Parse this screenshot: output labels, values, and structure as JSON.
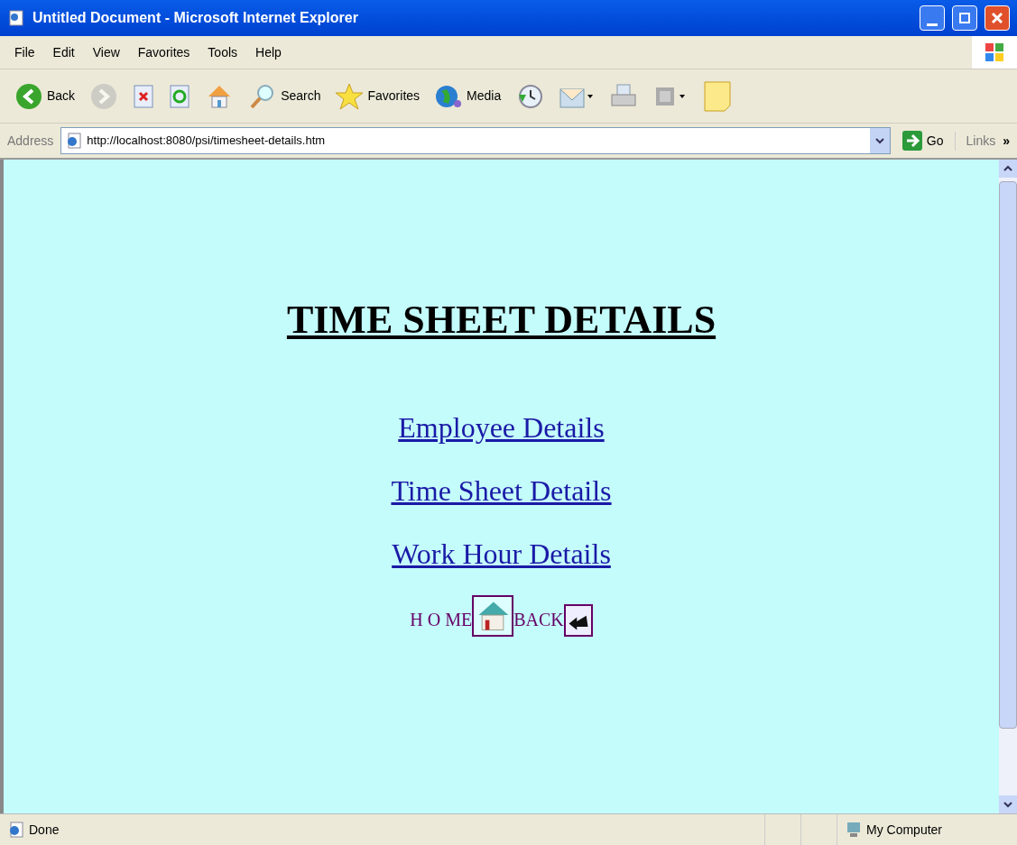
{
  "window": {
    "title": "Untitled Document - Microsoft Internet Explorer"
  },
  "menu": [
    "File",
    "Edit",
    "View",
    "Favorites",
    "Tools",
    "Help"
  ],
  "toolbar": [
    {
      "kind": "back",
      "label": "Back",
      "disabled": false
    },
    {
      "kind": "forward",
      "disabled": true
    },
    {
      "kind": "stop"
    },
    {
      "kind": "refresh"
    },
    {
      "kind": "home"
    },
    {
      "kind": "search",
      "label": "Search"
    },
    {
      "kind": "favorites",
      "label": "Favorites"
    },
    {
      "kind": "media",
      "label": "Media"
    },
    {
      "kind": "history"
    },
    {
      "kind": "mail"
    },
    {
      "kind": "print"
    },
    {
      "kind": "edit"
    },
    {
      "kind": "note"
    }
  ],
  "address": {
    "label": "Address",
    "url": "http://localhost:8080/psi/timesheet-details.htm",
    "go": "Go",
    "links": "Links",
    "more": "»"
  },
  "page": {
    "heading": "TIME SHEET DETAILS",
    "links": [
      "Employee Details",
      "Time Sheet Details",
      "Work Hour Details"
    ],
    "nav": [
      {
        "kind": "home",
        "label": "H O ME"
      },
      {
        "kind": "back",
        "label": "BACK"
      }
    ]
  },
  "status_bar": {
    "text": "Done",
    "zone": "My Computer"
  }
}
